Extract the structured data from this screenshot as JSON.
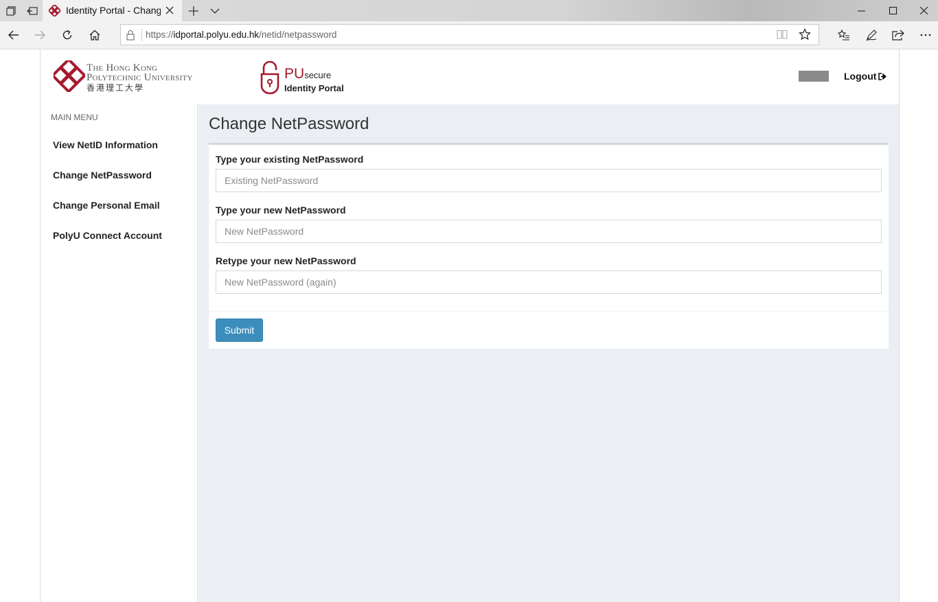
{
  "browser": {
    "tab_title": "Identity Portal - Change",
    "url_prefix": "https://",
    "url_host": "idportal.polyu.edu.hk",
    "url_path": "/netid/netpassword",
    "icons": {
      "tab_manager": "tab-manager-icon",
      "set_aside": "set-aside-tabs-icon",
      "new_tab": "plus-icon",
      "tab_list": "chevron-down-icon",
      "back": "arrow-left-icon",
      "forward": "arrow-right-icon",
      "refresh": "refresh-icon",
      "home": "home-icon",
      "lock": "lock-icon",
      "reading_view": "book-icon",
      "favorite": "star-icon",
      "favorites_hub": "favorites-list-icon",
      "notes": "pen-icon",
      "share": "share-icon",
      "more": "ellipsis-icon"
    }
  },
  "header": {
    "university_line1": "The Hong Kong",
    "university_line2": "Polytechnic University",
    "university_zh": "香港理工大學",
    "portal_pu": "PU",
    "portal_secure": "secure",
    "portal_name": "Identity Portal",
    "logout_label": "Logout",
    "brand_color": "#a6192e"
  },
  "sidebar": {
    "title": "MAIN MENU",
    "items": [
      {
        "label": "View NetID Information"
      },
      {
        "label": "Change NetPassword"
      },
      {
        "label": "Change Personal Email"
      },
      {
        "label": "PolyU Connect Account"
      }
    ]
  },
  "main": {
    "title": "Change NetPassword",
    "fields": [
      {
        "label": "Type your existing NetPassword",
        "placeholder": "Existing NetPassword",
        "value": ""
      },
      {
        "label": "Type your new NetPassword",
        "placeholder": "New NetPassword",
        "value": ""
      },
      {
        "label": "Retype your new NetPassword",
        "placeholder": "New NetPassword (again)",
        "value": ""
      }
    ],
    "submit_label": "Submit",
    "submit_color": "#3c8dbc"
  }
}
